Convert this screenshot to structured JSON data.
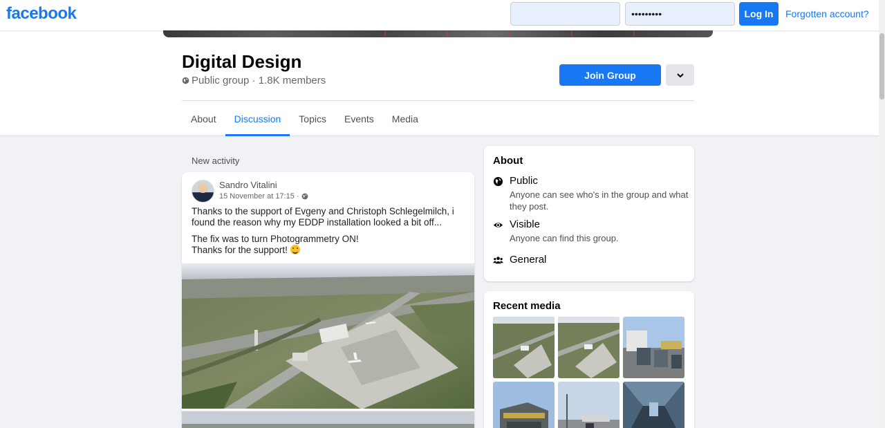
{
  "topbar": {
    "logo": "facebook",
    "email_value": "",
    "password_value": "•••••••••",
    "login_label": "Log In",
    "forgot_label": "Forgotten account?"
  },
  "group": {
    "title": "Digital Design",
    "meta": "Public group · 1.8K members",
    "join_label": "Join Group",
    "tabs": [
      {
        "label": "About"
      },
      {
        "label": "Discussion"
      },
      {
        "label": "Topics"
      },
      {
        "label": "Events"
      },
      {
        "label": "Media"
      }
    ],
    "active_tab": "Discussion"
  },
  "feed": {
    "section_label": "New activity",
    "post": {
      "author": "Sandro Vitalini",
      "time": "15 November at 17:15 ·",
      "paragraph1": "Thanks to the support of Evgeny and Christoph Schlegelmilch, i found the reason why my EDDP installation looked a bit off...",
      "line2": "The fix was to turn Photogrammetry ON!",
      "line3": "Thanks for the support!"
    }
  },
  "about": {
    "title": "About",
    "items": [
      {
        "heading": "Public",
        "desc": "Anyone can see who's in the group and what they post.",
        "icon": "globe-icon"
      },
      {
        "heading": "Visible",
        "desc": "Anyone can find this group.",
        "icon": "eye-icon"
      },
      {
        "heading": "General",
        "desc": "",
        "icon": "people-icon"
      }
    ]
  },
  "recent_media": {
    "title": "Recent media"
  },
  "colors": {
    "brand": "#1877f2",
    "page_bg": "#f0f2f5"
  }
}
